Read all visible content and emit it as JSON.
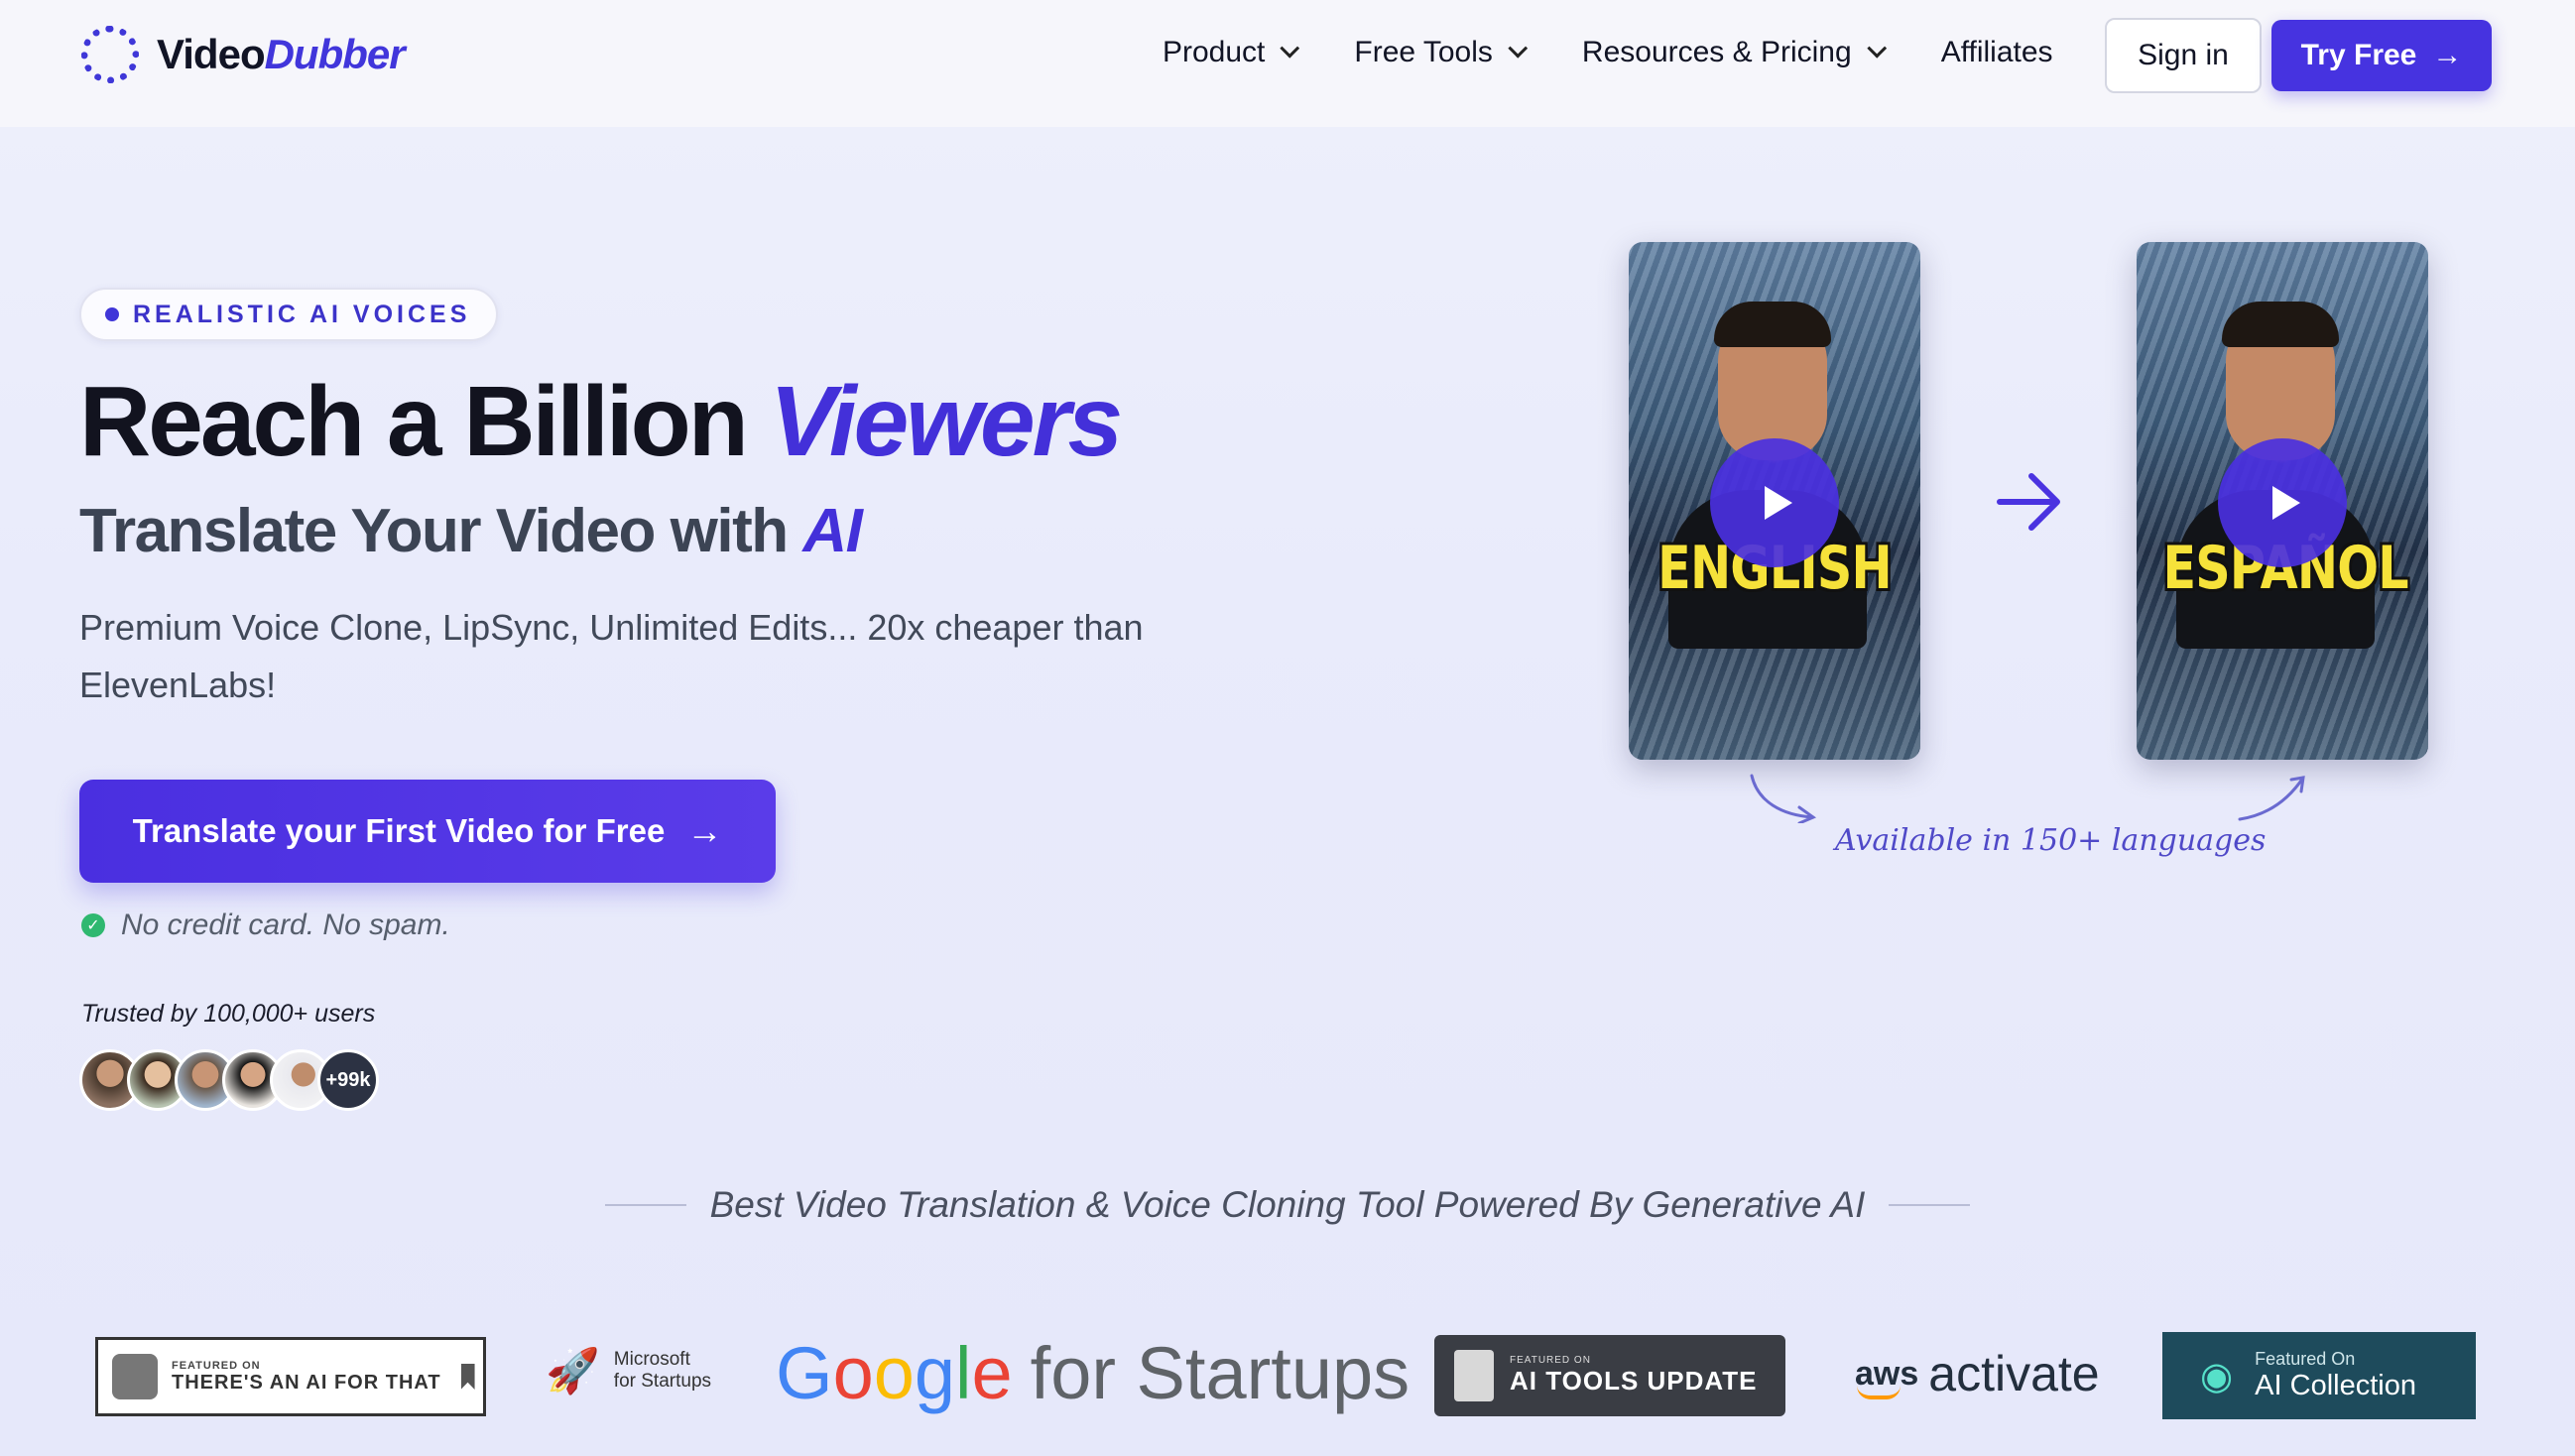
{
  "brand": {
    "name_part1": "Video",
    "name_part2": "Dubber"
  },
  "nav": {
    "items": [
      {
        "label": "Product",
        "dropdown": true
      },
      {
        "label": "Free Tools",
        "dropdown": true
      },
      {
        "label": "Resources & Pricing",
        "dropdown": true
      },
      {
        "label": "Affiliates",
        "dropdown": false
      }
    ],
    "sign_in": "Sign in",
    "try_free": "Try Free"
  },
  "hero": {
    "badge": "REALISTIC AI VOICES",
    "title_main": "Reach a Billion",
    "title_accent": "Viewers",
    "subtitle_main": "Translate Your Video with",
    "subtitle_accent": "AI",
    "lead": "Premium Voice Clone, LipSync, Unlimited Edits... 20x cheaper than ElevenLabs!",
    "cta": "Translate your First Video for Free",
    "no_card": "No credit card. No spam.",
    "trusted": "Trusted by 100,000+ users",
    "avatar_more": "+99k"
  },
  "demo": {
    "source_label": "ENGLISH",
    "target_label": "ESPAÑOL",
    "languages_note": "Available in 150+ languages"
  },
  "featured": {
    "tagline": "Best Video Translation & Voice Cloning Tool Powered By Generative AI",
    "logos": {
      "taaft_small": "FEATURED ON",
      "taaft_big": "THERE'S AN AI FOR THAT",
      "ms_line1": "Microsoft",
      "ms_line2": "for Startups",
      "google_letters": [
        "G",
        "o",
        "o",
        "g",
        "l",
        "e"
      ],
      "google_suffix": "for Startups",
      "aitools_small": "FEATURED ON",
      "aitools_big": "AI TOOLS UPDATE",
      "aws": "aws",
      "aws_activate": "activate",
      "aic_small": "Featured On",
      "aic_big": "AI Collection"
    }
  },
  "colors": {
    "accent": "#4633e0",
    "success": "#2fb870",
    "ai_collection_bg": "#1e4b5c"
  }
}
